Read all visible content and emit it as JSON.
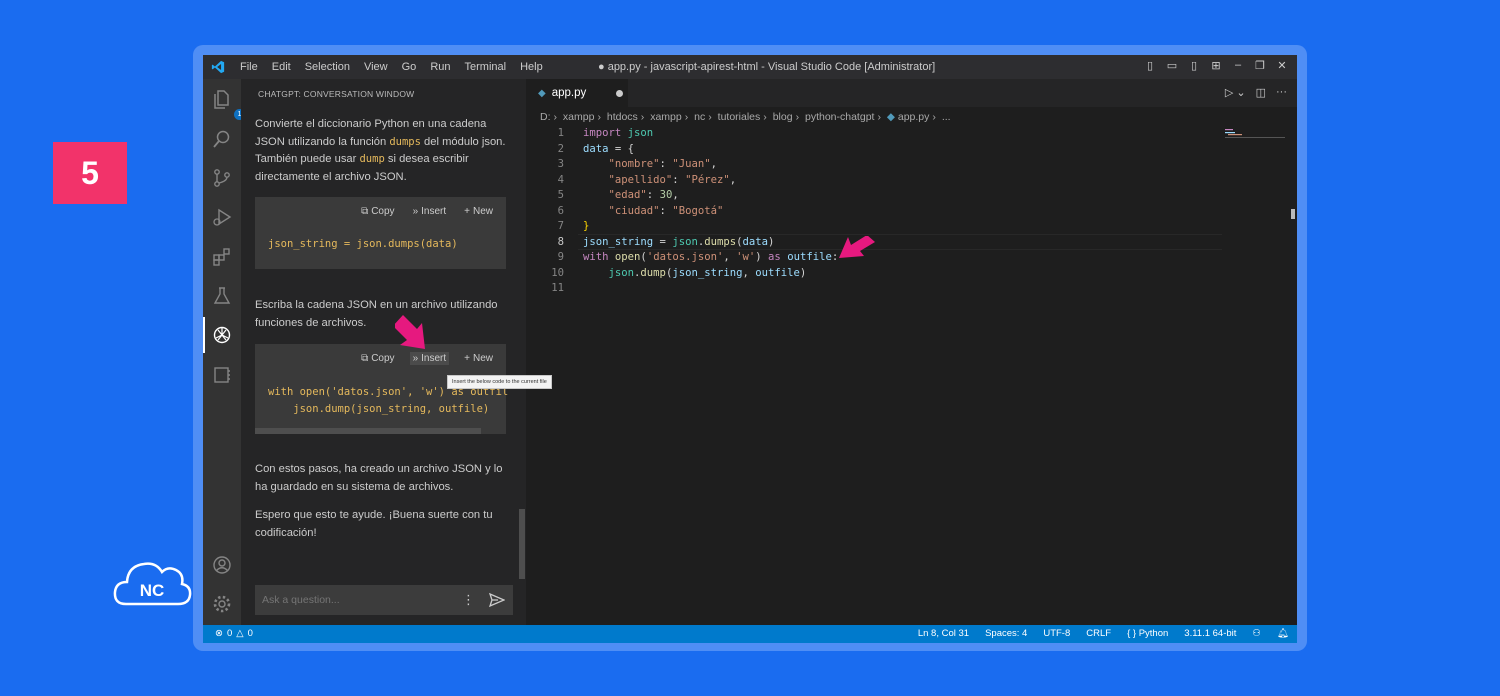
{
  "step": {
    "number": "5"
  },
  "logo": {
    "text": "NC"
  },
  "titlebar": {
    "menu": [
      "File",
      "Edit",
      "Selection",
      "View",
      "Go",
      "Run",
      "Terminal",
      "Help"
    ],
    "title": "● app.py - javascript-apirest-html - Visual Studio Code [Administrator]"
  },
  "activitybar": {
    "explorer_badge": "1"
  },
  "sidebar": {
    "title": "CHATGPT: CONVERSATION WINDOW",
    "para1_a": "Convierte el diccionario Python en una cadena JSON utilizando la función ",
    "para1_code1": "dumps",
    "para1_b": " del módulo json. También puede usar ",
    "para1_code2": "dump",
    "para1_c": " si desea escribir directamente el archivo JSON.",
    "block1": {
      "copy": "Copy",
      "insert": "Insert",
      "new": "New",
      "code": "json_string = json.dumps(data)"
    },
    "para2": "Escriba la cadena JSON en un archivo utilizando funciones de archivos.",
    "block2": {
      "copy": "Copy",
      "insert": "Insert",
      "new": "New",
      "code_line1": "with open('datos.json', 'w') as outfil",
      "code_line2": "    json.dump(json_string, outfile)"
    },
    "tooltip": "Insert the below code to the current file",
    "para3": "Con estos pasos, ha creado un archivo JSON y lo ha guardado en su sistema de archivos.",
    "para4": "Espero que esto te ayude. ¡Buena suerte con tu codificación!",
    "ask_placeholder": "Ask a question..."
  },
  "editor": {
    "tab_label": "app.py",
    "breadcrumb": [
      "D:",
      "xampp",
      "htdocs",
      "xampp",
      "nc",
      "tutoriales",
      "blog",
      "python-chatgpt",
      "app.py",
      "..."
    ],
    "line_numbers": [
      "1",
      "2",
      "3",
      "4",
      "5",
      "6",
      "7",
      "8",
      "9",
      "10",
      "11"
    ],
    "code": {
      "l1_kw": "import",
      "l1_mod": "json",
      "l2_var": "data",
      "l2_op": " = {",
      "l3_key": "\"nombre\"",
      "l3_val": "\"Juan\"",
      "l4_key": "\"apellido\"",
      "l4_val": "\"Pérez\"",
      "l5_key": "\"edad\"",
      "l5_val": "30",
      "l6_key": "\"ciudad\"",
      "l6_val": "\"Bogotá\"",
      "l7": "}",
      "l8_var": "json_string",
      "l8_mod": "json",
      "l8_fn": "dumps",
      "l8_arg": "data",
      "l9_kw": "with",
      "l9_fn": "open",
      "l9_s1": "'datos.json'",
      "l9_s2": "'w'",
      "l9_as": "as",
      "l9_var": "outfile",
      "l10_mod": "json",
      "l10_fn": "dump",
      "l10_a1": "json_string",
      "l10_a2": "outfile"
    }
  },
  "statusbar": {
    "errors": "0",
    "warnings": "0",
    "position": "Ln 8, Col 31",
    "spaces": "Spaces: 4",
    "encoding": "UTF-8",
    "eol": "CRLF",
    "language": "Python",
    "interpreter": "3.11.1 64-bit"
  },
  "colors": {
    "background": "#1a6cf0",
    "badge": "#f2336a",
    "statusbar": "#007acc",
    "arrow": "#e6197f"
  }
}
